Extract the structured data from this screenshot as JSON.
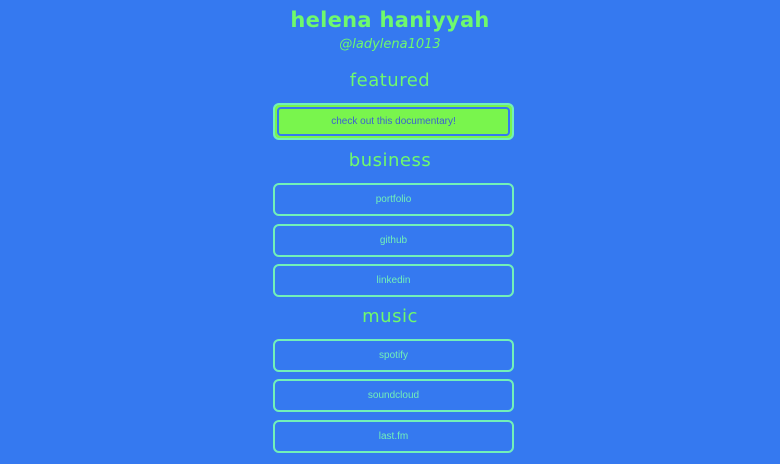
{
  "profile": {
    "name": "helena haniyyah",
    "handle": "@ladylena1013"
  },
  "sections": {
    "featured": {
      "title": "featured",
      "links": [
        "check out this documentary!"
      ]
    },
    "business": {
      "title": "business",
      "links": [
        "portfolio",
        "github",
        "linkedin"
      ]
    },
    "music": {
      "title": "music",
      "links": [
        "spotify",
        "soundcloud",
        "last.fm"
      ]
    }
  },
  "colors": {
    "background": "#3579f0",
    "accent_green": "#6ef96d",
    "button_border": "#72f0b8",
    "featured_fill": "#79f54d"
  }
}
